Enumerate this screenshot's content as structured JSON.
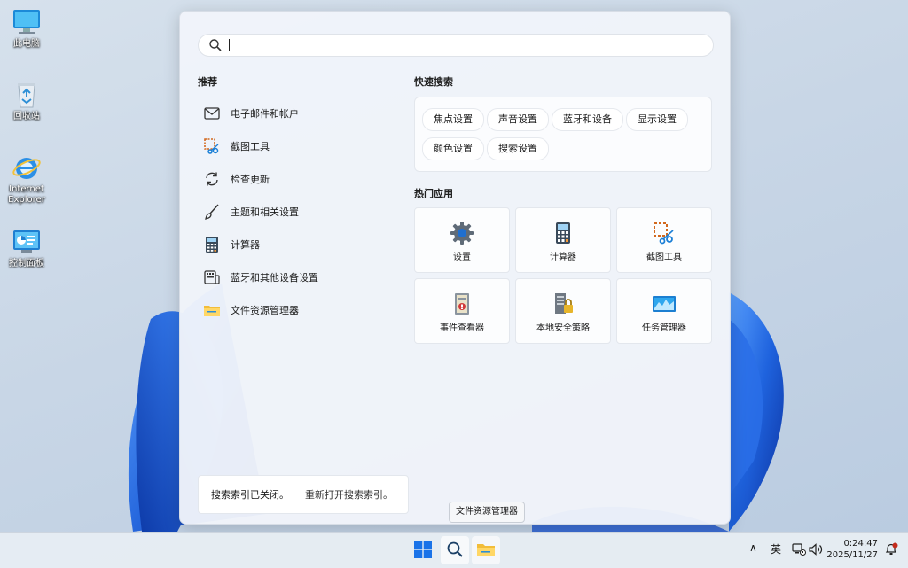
{
  "desktop": {
    "icons": [
      {
        "label": "此电脑",
        "icon": "computer-icon"
      },
      {
        "label": "回收站",
        "icon": "recycle-bin-icon"
      },
      {
        "label": "Internet Explorer",
        "icon": "internet-explorer-icon"
      },
      {
        "label": "控制面板",
        "icon": "control-panel-icon"
      }
    ]
  },
  "search": {
    "value": "",
    "placeholder": ""
  },
  "recommended": {
    "title": "推荐",
    "items": [
      {
        "label": "电子邮件和帐户",
        "icon": "mail-icon"
      },
      {
        "label": "截图工具",
        "icon": "snipping-tool-icon"
      },
      {
        "label": "检查更新",
        "icon": "refresh-icon"
      },
      {
        "label": "主题和相关设置",
        "icon": "brush-icon"
      },
      {
        "label": "计算器",
        "icon": "calculator-icon"
      },
      {
        "label": "蓝牙和其他设备设置",
        "icon": "devices-icon"
      },
      {
        "label": "文件资源管理器",
        "icon": "folder-icon"
      }
    ]
  },
  "quick_search": {
    "title": "快速搜索",
    "chips": [
      "焦点设置",
      "声音设置",
      "蓝牙和设备",
      "显示设置",
      "颜色设置",
      "搜索设置"
    ]
  },
  "top_apps": {
    "title": "热门应用",
    "tiles": [
      {
        "label": "设置",
        "icon": "settings-gear-icon"
      },
      {
        "label": "计算器",
        "icon": "calculator-icon"
      },
      {
        "label": "截图工具",
        "icon": "snipping-tool-icon"
      },
      {
        "label": "事件查看器",
        "icon": "event-viewer-icon"
      },
      {
        "label": "本地安全策略",
        "icon": "security-policy-icon"
      },
      {
        "label": "任务管理器",
        "icon": "task-manager-icon"
      }
    ]
  },
  "notice": {
    "text": "搜索索引已关闭。",
    "link": "重新打开搜索索引。"
  },
  "tooltip": "文件资源管理器",
  "taskbar": {
    "tray_chevron": "∧",
    "ime": "英",
    "time": "0:24:47",
    "date": "2025/11/27"
  },
  "colors": {
    "accent": "#0067c0",
    "wallpaper_blue": "#1d5fd6"
  }
}
